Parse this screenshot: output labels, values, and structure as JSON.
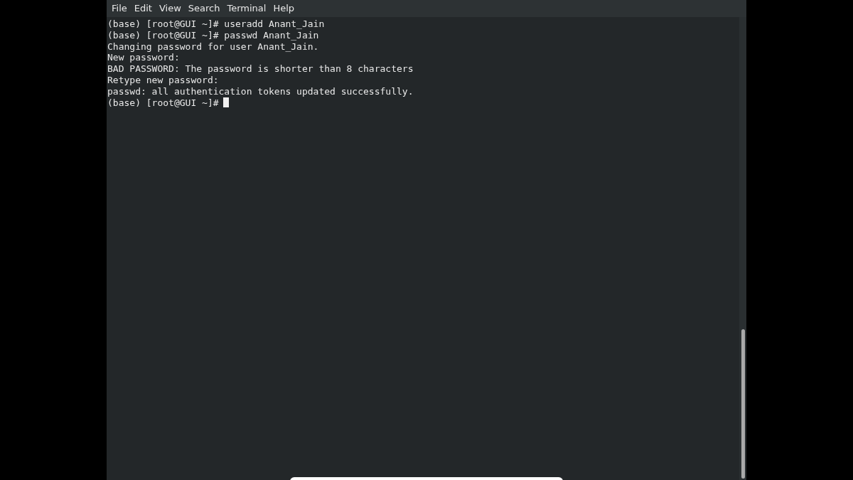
{
  "menu_bar": {
    "items": [
      "File",
      "Edit",
      "View",
      "Search",
      "Terminal",
      "Help"
    ]
  },
  "terminal": {
    "lines": [
      "(base) [root@GUI ~]# useradd Anant_Jain",
      "(base) [root@GUI ~]# passwd Anant_Jain",
      "Changing password for user Anant_Jain.",
      "New password:",
      "BAD PASSWORD: The password is shorter than 8 characters",
      "Retype new password:",
      "passwd: all authentication tokens updated successfully.",
      "(base) [root@GUI ~]#"
    ],
    "cursor_visible": true
  }
}
